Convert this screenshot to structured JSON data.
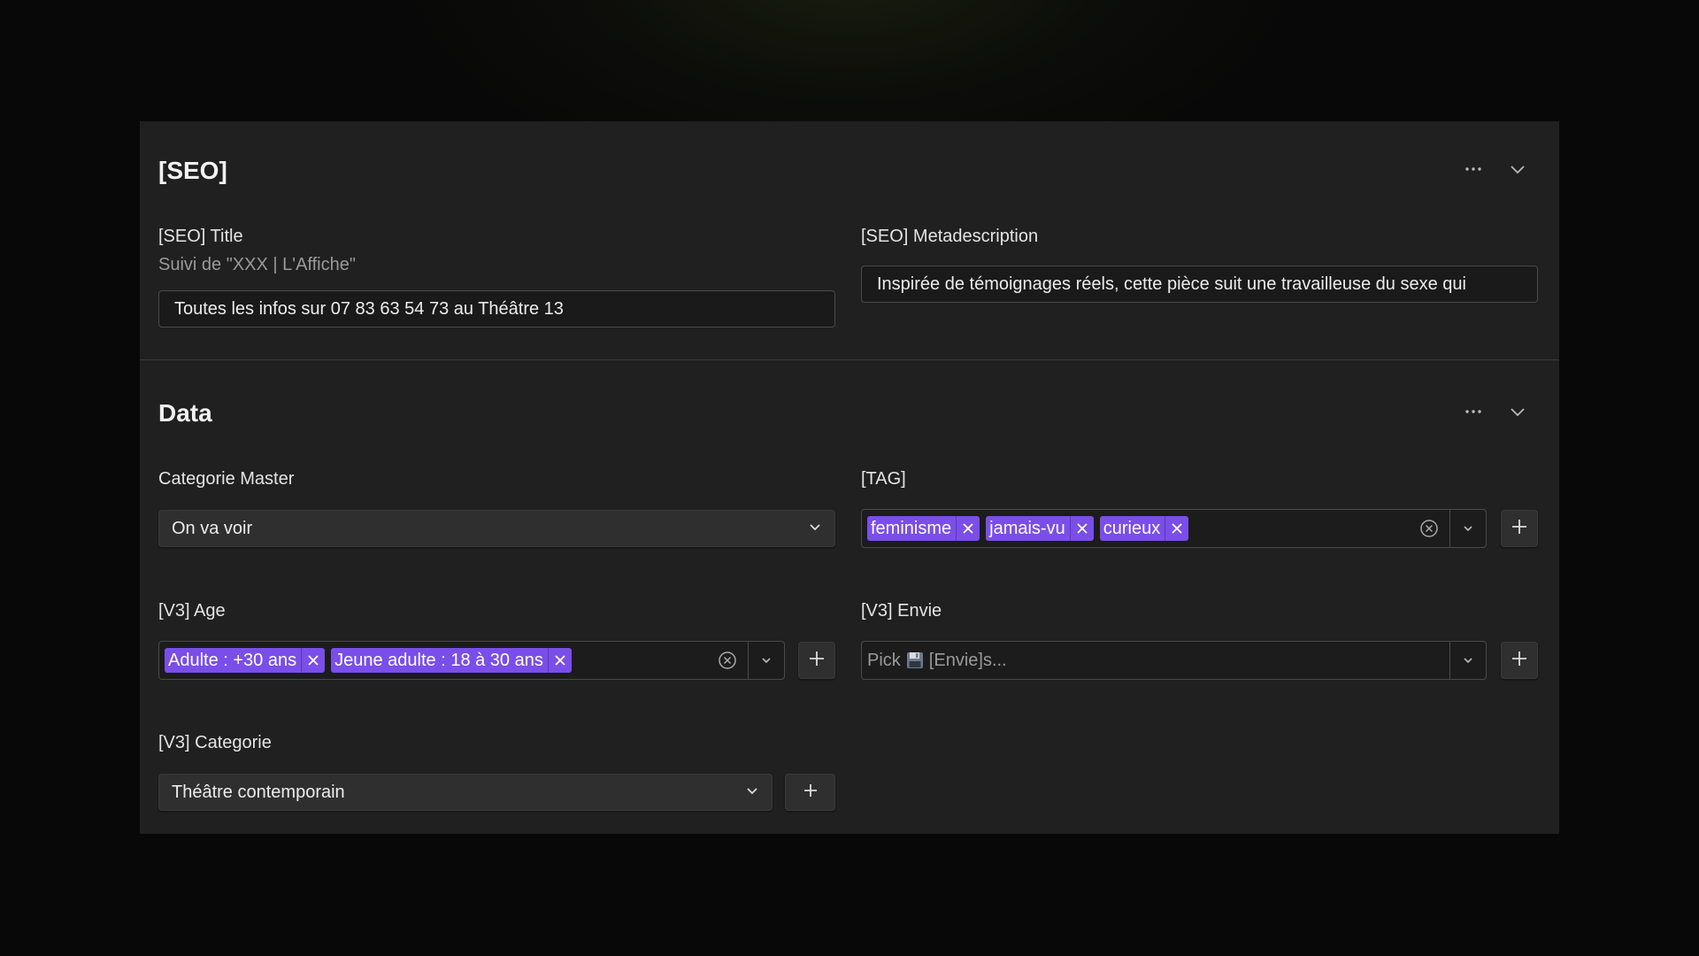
{
  "seo": {
    "title": "[SEO]",
    "title_field": {
      "label": "[SEO] Title",
      "hint": "Suivi de \"XXX | L'Affiche\"",
      "value": "Toutes les infos sur 07 83 63 54 73 au Théâtre 13"
    },
    "meta_field": {
      "label": "[SEO] Metadescription",
      "value": "Inspirée de témoignages réels, cette pièce suit une travailleuse du sexe qui"
    }
  },
  "data": {
    "title": "Data",
    "categorie_master": {
      "label": "Categorie Master",
      "value": "On va voir"
    },
    "tag": {
      "label": "[TAG]",
      "tags": [
        "feminisme",
        "jamais-vu",
        "curieux"
      ]
    },
    "age": {
      "label": "[V3] Age",
      "tags": [
        "Adulte : +30 ans",
        "Jeune adulte : 18 à 30 ans"
      ]
    },
    "envie": {
      "label": "[V3] Envie",
      "placeholder_prefix": "Pick",
      "placeholder_suffix": "[Envie]s..."
    },
    "categorie": {
      "label": "[V3] Categorie",
      "value": "Théâtre contemporain"
    }
  },
  "icons": {
    "more": "more-horizontal-icon",
    "collapse": "chevron-down-icon",
    "remove": "close-icon",
    "clear": "clear-circle-icon",
    "add": "plus-icon",
    "floppy": "floppy-disk-icon"
  },
  "colors": {
    "tag_bg": "#7a4ee8",
    "panel_bg": "#202020",
    "page_bg": "#080808"
  }
}
